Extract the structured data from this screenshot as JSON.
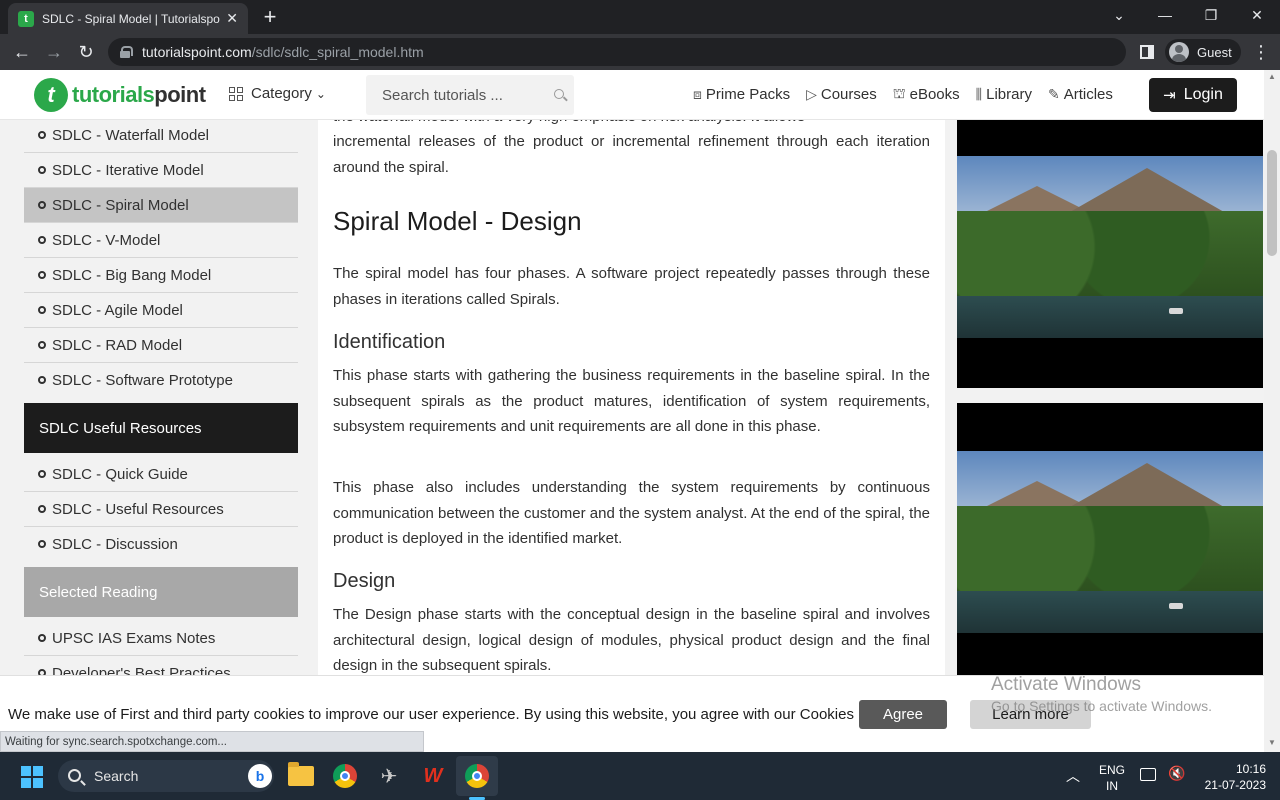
{
  "browser": {
    "tab_title": "SDLC - Spiral Model | Tutorialspo",
    "favicon_letter": "t",
    "url_host": "tutorialspoint.com",
    "url_path": "/sdlc/sdlc_spiral_model.htm",
    "profile_name": "Guest",
    "status_text": "Waiting for sync.search.spotxchange.com..."
  },
  "header": {
    "logo_mark": "t",
    "logo_word_1": "tutorials",
    "logo_word_2": "point",
    "category_label": "Category",
    "search_placeholder": "Search tutorials ...",
    "nav": [
      "Prime Packs",
      "Courses",
      "eBooks",
      "Library",
      "Articles"
    ],
    "login_label": "Login"
  },
  "sidebar": {
    "items_top": [
      "SDLC - Waterfall Model",
      "SDLC - Iterative Model",
      "SDLC - Spiral Model",
      "SDLC - V-Model",
      "SDLC - Big Bang Model",
      "SDLC - Agile Model",
      "SDLC - RAD Model",
      "SDLC - Software Prototype"
    ],
    "active_item": "SDLC - Spiral Model",
    "resources_heading": "SDLC Useful Resources",
    "resources_items": [
      "SDLC - Quick Guide",
      "SDLC - Useful Resources",
      "SDLC - Discussion"
    ],
    "reading_heading": "Selected Reading",
    "reading_items": [
      "UPSC IAS Exams Notes",
      "Developer's Best Practices"
    ]
  },
  "article": {
    "intro_partial_top": "the waterfall model with a very high emphasis on risk analysis. It allows",
    "intro_rest": "incremental releases of the product or incremental refinement through each iteration around the spiral.",
    "design_heading": "Spiral Model - Design",
    "design_para": "The spiral model has four phases. A software project repeatedly passes through these phases in iterations called Spirals.",
    "identification_heading": "Identification",
    "identification_para_1": "This phase starts with gathering the business requirements in the baseline spiral. In the subsequent spirals as the product matures, identification of system requirements, subsystem requirements and unit requirements are all done in this phase.",
    "identification_para_2": "This phase also includes understanding the system requirements by continuous communication between the customer and the system analyst. At the end of the spiral, the product is deployed in the identified market.",
    "design_sub_heading": "Design",
    "design_sub_para": "The Design phase starts with the conceptual design in the baseline spiral and involves architectural design, logical design of modules, physical product design and the final design in the subsequent spirals."
  },
  "cookie_banner": {
    "message": "We make use of First and third party cookies to improve our user experience. By using this website, you agree with our Cookies Policy.",
    "agree_label": "Agree",
    "learn_more_label": "Learn more"
  },
  "watermark": {
    "line1": "Activate Windows",
    "line2": "Go to Settings to activate Windows."
  },
  "taskbar": {
    "search_label": "Search",
    "bing_letter": "b",
    "lang_line1": "ENG",
    "lang_line2": "IN",
    "time": "10:16",
    "date": "21-07-2023"
  },
  "colors": {
    "brand_green": "#2ba84a",
    "dark": "#1c1c1c",
    "sidebar_bg": "#f2f2f2"
  }
}
